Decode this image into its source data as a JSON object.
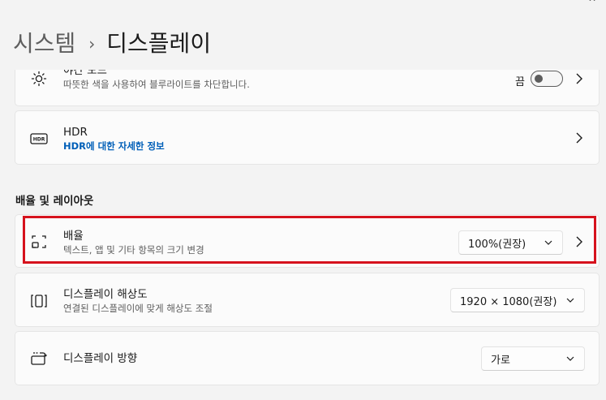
{
  "window": {
    "maximize_label": "",
    "close_label": "✕"
  },
  "breadcrumb": {
    "parent": "시스템",
    "separator": "›",
    "current": "디스플레이"
  },
  "night_light": {
    "title": "야간 모드",
    "subtitle": "따뜻한 색을 사용하여 블루라이트를 차단합니다.",
    "toggle_state": "끔"
  },
  "hdr": {
    "title": "HDR",
    "link": "HDR에 대한 자세한 정보"
  },
  "section_scale_layout": "배율 및 레이아웃",
  "scale": {
    "title": "배율",
    "subtitle": "텍스트, 앱 및 기타 항목의 크기 변경",
    "value": "100%(권장)"
  },
  "resolution": {
    "title": "디스플레이 해상도",
    "subtitle": "연결된 디스플레이에 맞게 해상도 조절",
    "value": "1920 × 1080(권장)"
  },
  "orientation": {
    "title": "디스플레이 방향",
    "value": "가로"
  },
  "colors": {
    "accent_link": "#005fb8",
    "highlight": "#d6121d"
  }
}
